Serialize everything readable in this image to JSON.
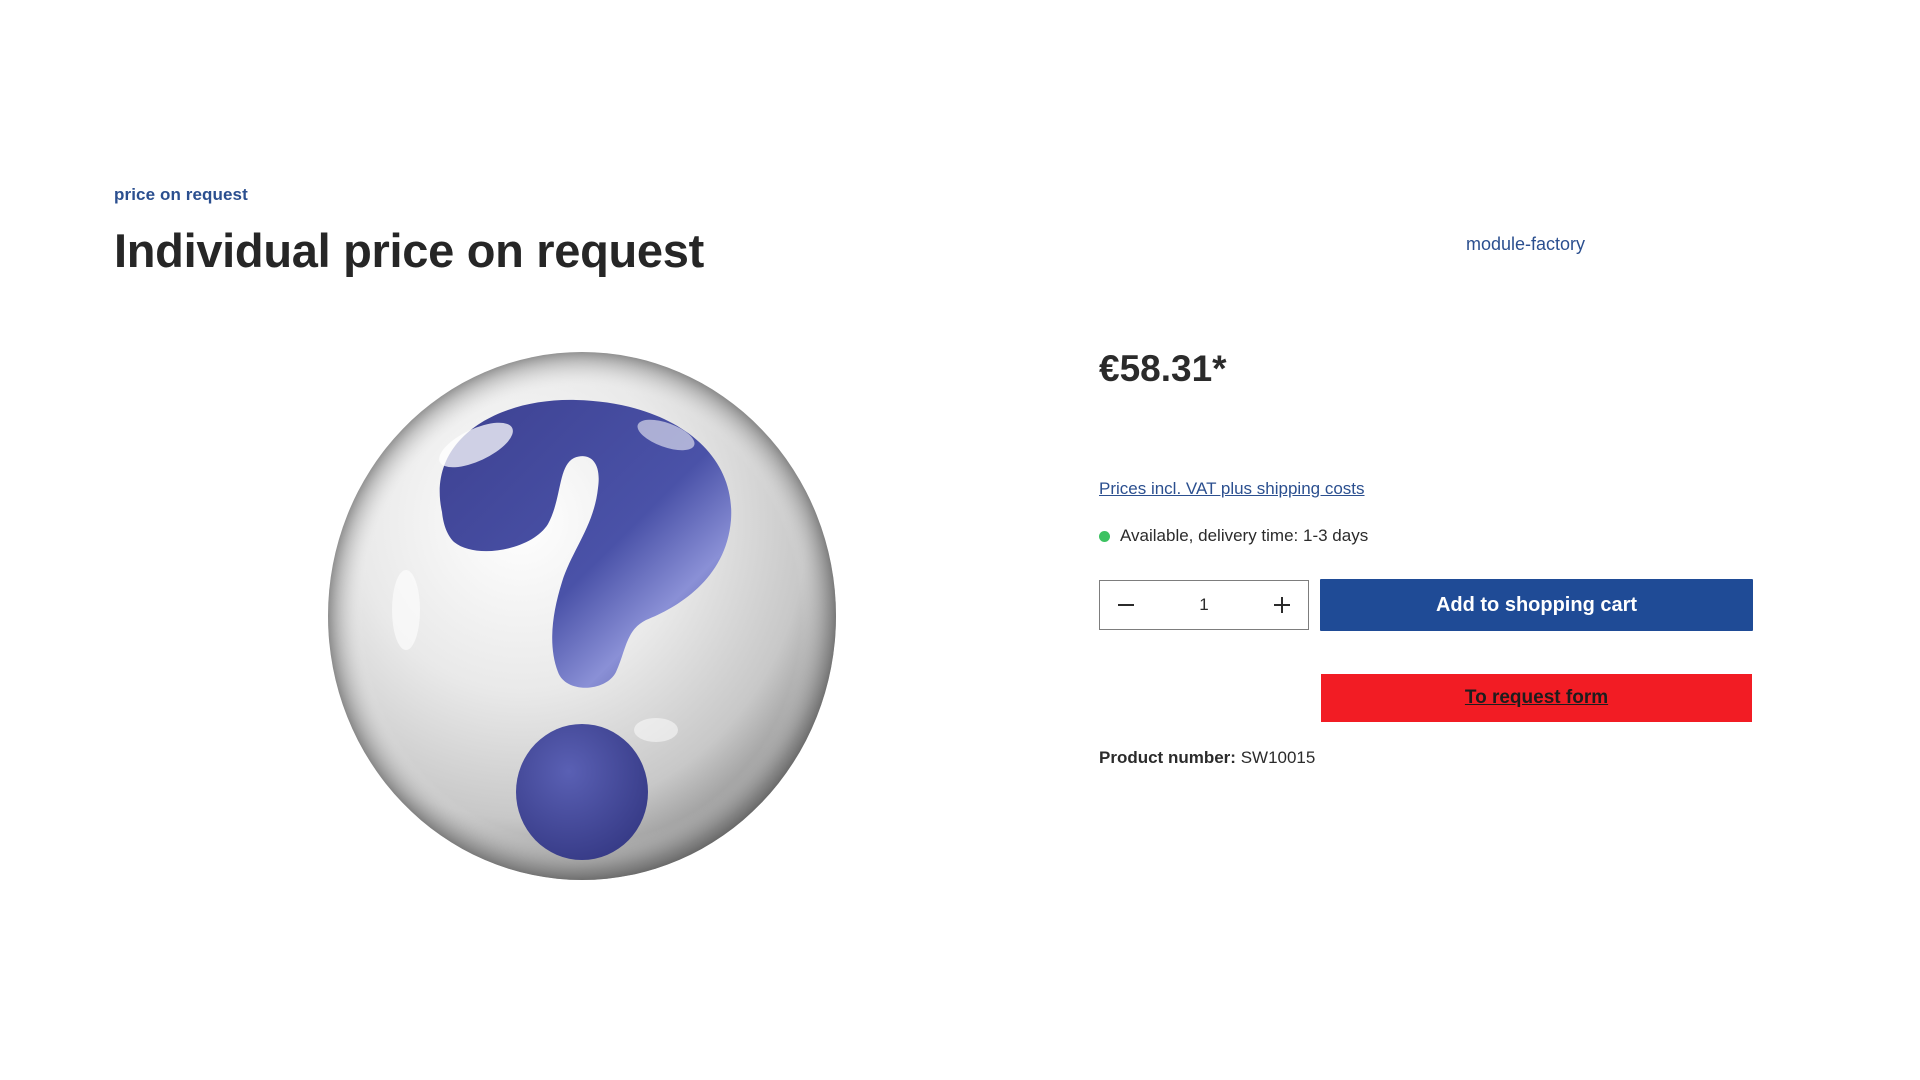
{
  "product": {
    "manufacturer_link": "price on request",
    "title": "Individual price on request",
    "vendor": "module-factory",
    "price": "€58.31*",
    "vat_note": "Prices incl. VAT plus shipping costs",
    "availability": "Available, delivery time: 1-3 days",
    "product_number_label": "Product number:",
    "product_number_value": "SW10015"
  },
  "buy_box": {
    "quantity": "1",
    "add_to_cart_label": "Add to shopping cart",
    "request_form_label": "To request form"
  },
  "colors": {
    "primary": "#1f4b96",
    "request_button": "#f21c24",
    "link": "#2b4f8f",
    "available_dot": "#3cc261"
  },
  "icons": {
    "decrease": "minus-icon",
    "increase": "plus-icon",
    "availability": "status-dot-icon"
  }
}
